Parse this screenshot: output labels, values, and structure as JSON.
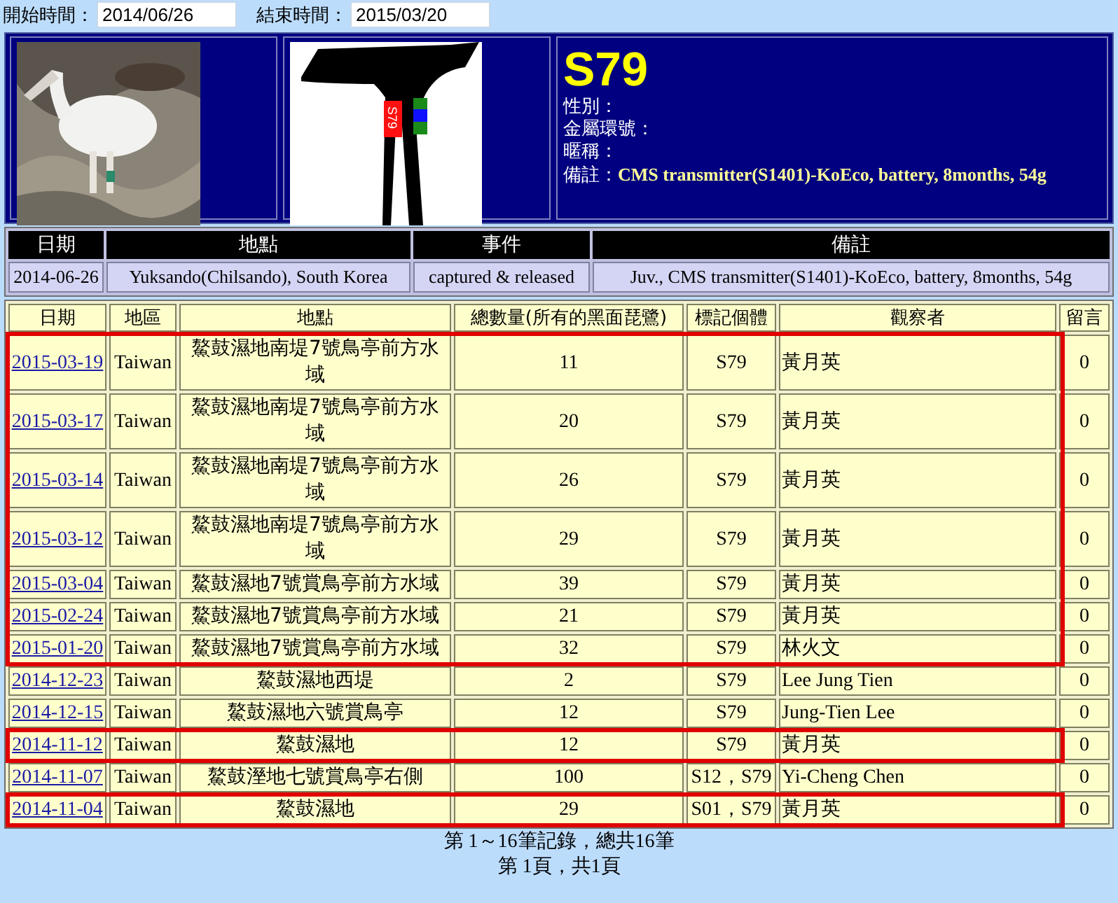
{
  "filters": [
    {
      "label": "開始時間：",
      "value": "2014/06/26"
    },
    {
      "label": "結束時間：",
      "value": "2015/03/20"
    }
  ],
  "bird": {
    "code": "S79",
    "band_label": "S79",
    "fields": [
      {
        "label": "性別："
      },
      {
        "label": "金屬環號："
      },
      {
        "label": "暱稱："
      },
      {
        "label": "備註：",
        "value": "CMS transmitter(S1401)-KoEco, battery, 8months, 54g"
      }
    ]
  },
  "events": {
    "columns": [
      "日期",
      "地點",
      "事件",
      "備註"
    ],
    "rows": [
      [
        "2014-06-26",
        "Yuksando(Chilsando), South Korea",
        "captured & released",
        "Juv., CMS transmitter(S1401)-KoEco, battery, 8months, 54g"
      ]
    ]
  },
  "table": {
    "columns": [
      "日期",
      "地區",
      "地點",
      "總數量(所有的黑面琵鷺)",
      "標記個體",
      "觀察者",
      "留言"
    ],
    "rows": [
      {
        "date": "2015-03-19",
        "area": "Taiwan",
        "place": "鰲鼓濕地南堤7號鳥亭前方水域",
        "count": "11",
        "tags": "S79",
        "observer": "黃月英",
        "comments": "0",
        "highlighted": true
      },
      {
        "date": "2015-03-17",
        "area": "Taiwan",
        "place": "鰲鼓濕地南堤7號鳥亭前方水域",
        "count": "20",
        "tags": "S79",
        "observer": "黃月英",
        "comments": "0",
        "highlighted": true
      },
      {
        "date": "2015-03-14",
        "area": "Taiwan",
        "place": "鰲鼓濕地南堤7號鳥亭前方水域",
        "count": "26",
        "tags": "S79",
        "observer": "黃月英",
        "comments": "0",
        "highlighted": true
      },
      {
        "date": "2015-03-12",
        "area": "Taiwan",
        "place": "鰲鼓濕地南堤7號鳥亭前方水域",
        "count": "29",
        "tags": "S79",
        "observer": "黃月英",
        "comments": "0",
        "highlighted": true
      },
      {
        "date": "2015-03-04",
        "area": "Taiwan",
        "place": "鰲鼓濕地7號賞鳥亭前方水域",
        "count": "39",
        "tags": "S79",
        "observer": "黃月英",
        "comments": "0",
        "highlighted": true
      },
      {
        "date": "2015-02-24",
        "area": "Taiwan",
        "place": "鰲鼓濕地7號賞鳥亭前方水域",
        "count": "21",
        "tags": "S79",
        "observer": "黃月英",
        "comments": "0",
        "highlighted": true
      },
      {
        "date": "2015-01-20",
        "area": "Taiwan",
        "place": "鰲鼓濕地7號賞鳥亭前方水域",
        "count": "32",
        "tags": "S79",
        "observer": "林火文",
        "comments": "0",
        "highlighted": true
      },
      {
        "date": "2014-12-23",
        "area": "Taiwan",
        "place": "鰲鼓濕地西堤",
        "count": "2",
        "tags": "S79",
        "observer": "Lee Jung Tien",
        "comments": "0",
        "highlighted": false
      },
      {
        "date": "2014-12-15",
        "area": "Taiwan",
        "place": "鰲鼓濕地六號賞鳥亭",
        "count": "12",
        "tags": "S79",
        "observer": "Jung-Tien Lee",
        "comments": "0",
        "highlighted": false
      },
      {
        "date": "2014-11-12",
        "area": "Taiwan",
        "place": "鰲鼓濕地",
        "count": "12",
        "tags": "S79",
        "observer": "黃月英",
        "comments": "0",
        "highlighted": true
      },
      {
        "date": "2014-11-07",
        "area": "Taiwan",
        "place": "鰲鼓溼地七號賞鳥亭右側",
        "count": "100",
        "tags": "S12，S79",
        "observer": "Yi-Cheng Chen",
        "comments": "0",
        "highlighted": false
      },
      {
        "date": "2014-11-04",
        "area": "Taiwan",
        "place": "鰲鼓濕地",
        "count": "29",
        "tags": "S01，S79",
        "observer": "黃月英",
        "comments": "0",
        "highlighted": true
      }
    ]
  },
  "footer": [
    "第 1～16筆記錄，總共16筆",
    "第 1頁，共1頁"
  ]
}
